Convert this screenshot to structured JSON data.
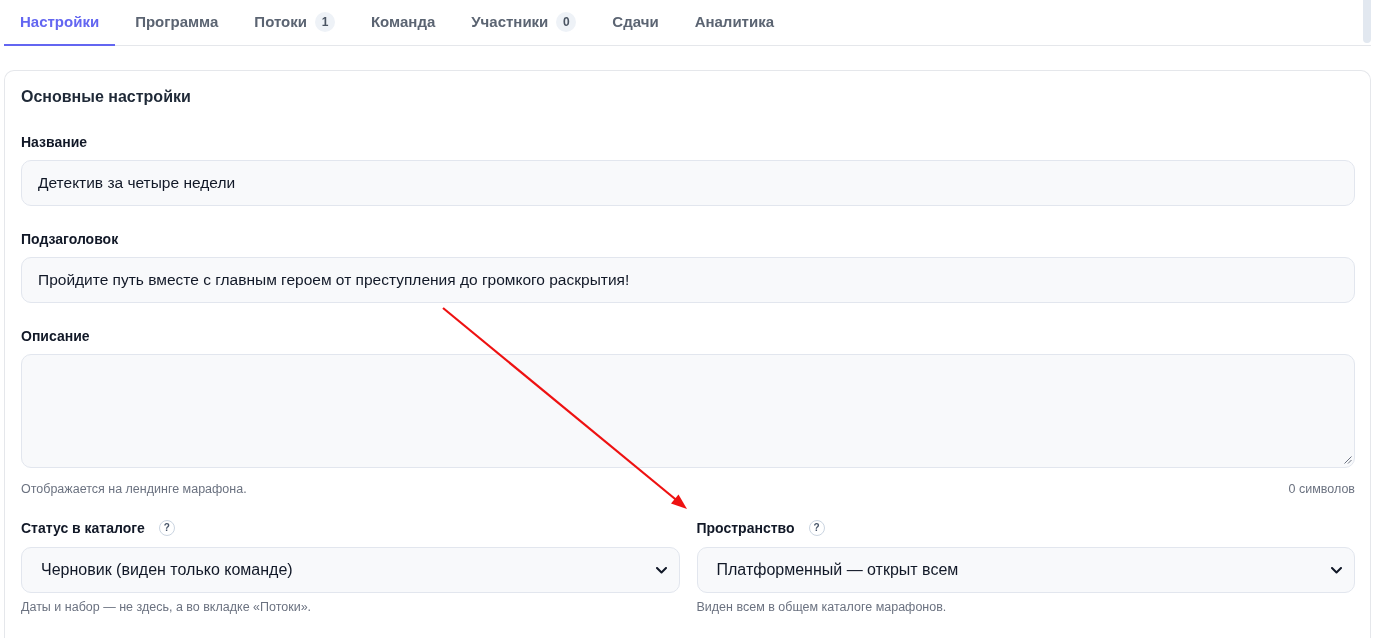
{
  "tabs": [
    {
      "label": "Настройки",
      "selected": true
    },
    {
      "label": "Программа",
      "selected": false
    },
    {
      "label": "Потоки",
      "count": "1",
      "selected": false
    },
    {
      "label": "Команда",
      "selected": false
    },
    {
      "label": "Участники",
      "count": "0",
      "selected": false
    },
    {
      "label": "Сдачи",
      "selected": false
    },
    {
      "label": "Аналитика",
      "selected": false
    }
  ],
  "section": {
    "title": "Основные настройки",
    "fields": [
      {
        "kind": "text",
        "label": "Название",
        "value": "Детектив за четыре недели"
      },
      {
        "kind": "text",
        "label": "Подзаголовок",
        "value": "Пройдите путь вместе с главным героем от преступления до громкого раскрытия!"
      },
      {
        "kind": "textarea",
        "label": "Описание",
        "help": "Отображается на лендинге марафона.",
        "counter": "0 символов"
      }
    ],
    "selects": [
      {
        "label": "Статус в каталоге",
        "hint": "?",
        "value": "Черновик (виден только команде)",
        "help": "Даты и набор — не здесь, а во вкладке «Потоки»."
      },
      {
        "label": "Пространство",
        "hint": "?",
        "value": "Платформенный — открыт всем",
        "help": "Виден всем в общем каталоге марафонов."
      }
    ]
  },
  "annotations": [
    {
      "kind": "arrow"
    }
  ]
}
